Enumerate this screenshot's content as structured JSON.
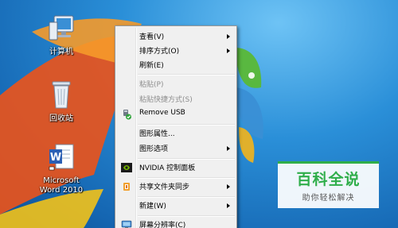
{
  "desktop_icons": [
    {
      "id": "computer",
      "label": "计算机"
    },
    {
      "id": "recycle_bin",
      "label": "回收站"
    },
    {
      "id": "word",
      "label": "Microsoft Word 2010"
    }
  ],
  "context_menu": {
    "items": [
      {
        "label": "查看(V)",
        "submenu": true,
        "enabled": true
      },
      {
        "label": "排序方式(O)",
        "submenu": true,
        "enabled": true
      },
      {
        "label": "刷新(E)",
        "submenu": false,
        "enabled": true
      },
      {
        "label": "粘贴(P)",
        "submenu": false,
        "enabled": false
      },
      {
        "label": "粘贴快捷方式(S)",
        "submenu": false,
        "enabled": false
      },
      {
        "label": "Remove USB",
        "submenu": false,
        "enabled": true,
        "icon": "usb-remove-icon"
      },
      {
        "label": "图形属性...",
        "submenu": false,
        "enabled": true
      },
      {
        "label": "图形选项",
        "submenu": true,
        "enabled": true
      },
      {
        "label": "NVIDIA 控制面板",
        "submenu": false,
        "enabled": true,
        "icon": "nvidia-icon"
      },
      {
        "label": "共享文件夹同步",
        "submenu": true,
        "enabled": true,
        "icon": "folder-sync-icon"
      },
      {
        "label": "新建(W)",
        "submenu": true,
        "enabled": true
      },
      {
        "label": "屏幕分辨率(C)",
        "submenu": false,
        "enabled": true,
        "icon": "display-icon"
      }
    ]
  },
  "watermark": {
    "brand": "百科全说",
    "tagline": "助你轻松解决",
    "accent": "#2fae4a"
  }
}
